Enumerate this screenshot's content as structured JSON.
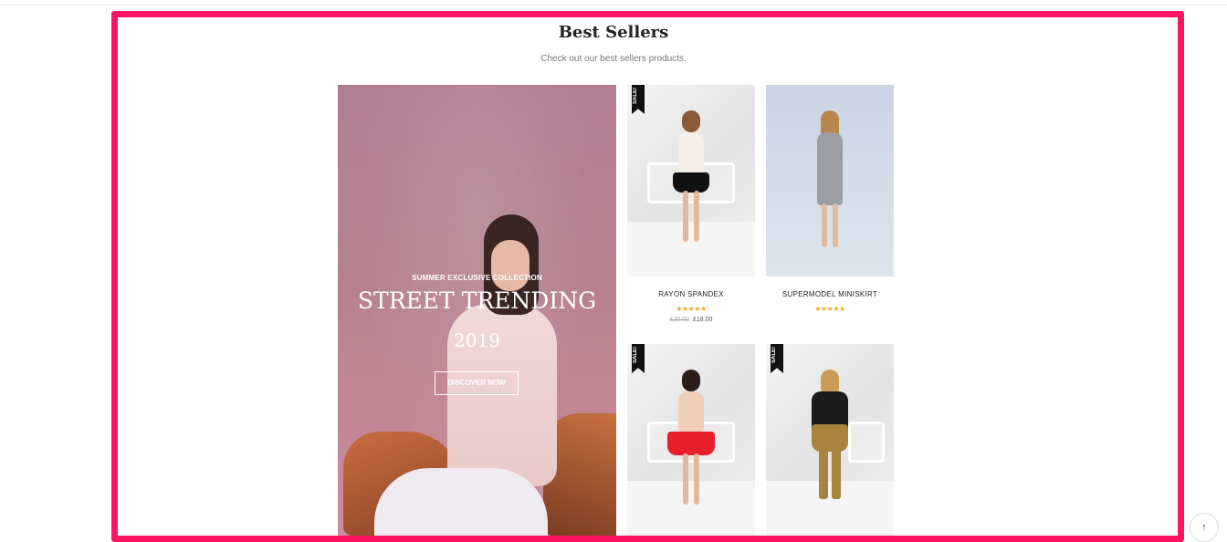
{
  "section": {
    "title": "Best Sellers",
    "subtitle": "Check out our best sellers products."
  },
  "banner": {
    "kicker": "SUMMER EXCLUSIVE COLLECTION",
    "title": "STREET TRENDING",
    "year": "2019",
    "button_label": "DISCOVER NOW"
  },
  "products": [
    {
      "name": "RAYON SPANDEX",
      "badge": "SALE!",
      "rating": "★★★★★",
      "old_price": "£20.00",
      "price": "£18.00"
    },
    {
      "name": "SUPERMODEL MINISKIRT",
      "badge": "",
      "rating": "★★★★★",
      "old_price": "",
      "price": ""
    },
    {
      "name": "",
      "badge": "SALE!",
      "rating": "",
      "old_price": "",
      "price": ""
    },
    {
      "name": "",
      "badge": "SALE!",
      "rating": "",
      "old_price": "",
      "price": ""
    }
  ],
  "scroll_top": {
    "icon": "arrow-up-icon",
    "glyph": "↑"
  },
  "colors": {
    "highlight": "#ff1464",
    "star": "#f5a623",
    "banner_bg": "#b4818f"
  }
}
